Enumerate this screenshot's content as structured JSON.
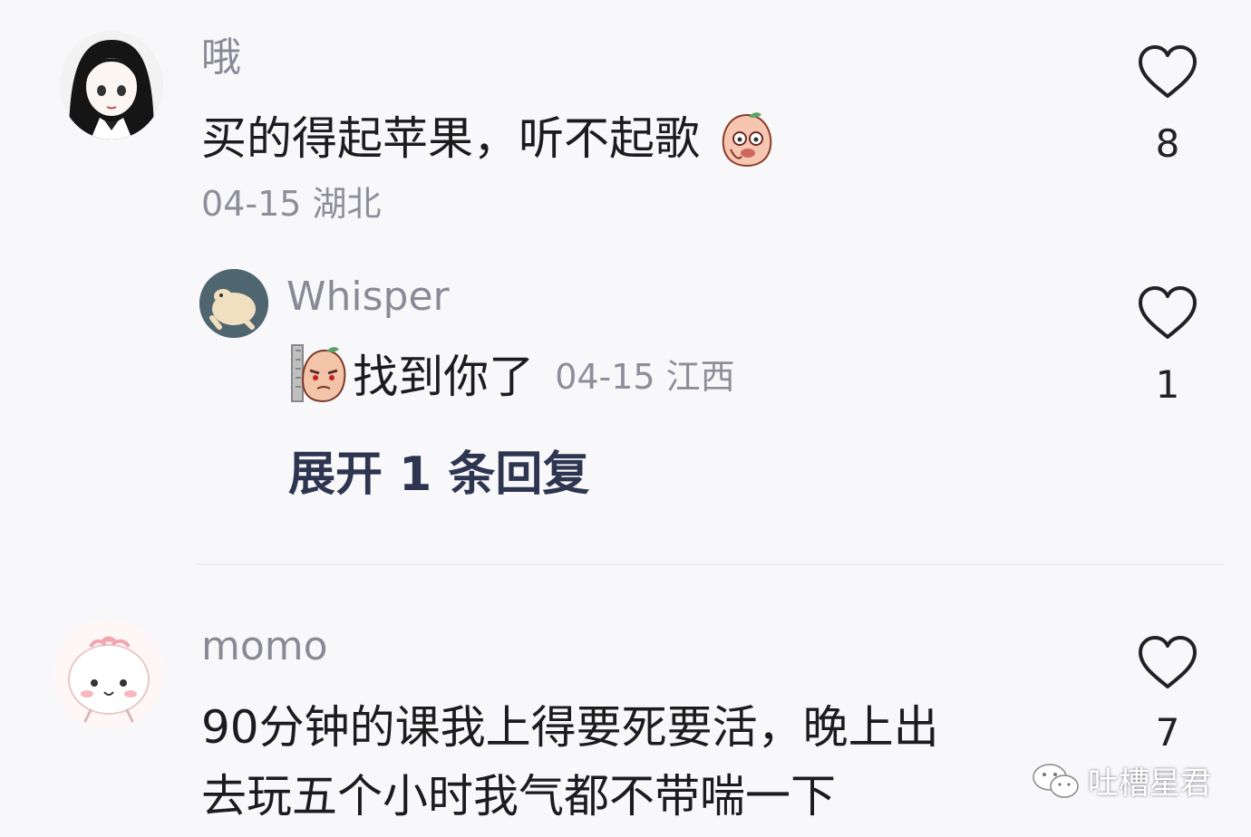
{
  "comments": [
    {
      "username": "哦",
      "text": "买的得起苹果，听不起歌",
      "meta": "04-15 湖北",
      "likes": "8"
    },
    {
      "username": "momo",
      "text_line1": "90分钟的课我上得要死要活，晚上出",
      "text_line2": "去玩五个小时我气都不带喘一下",
      "likes": "7"
    }
  ],
  "reply": {
    "username": "Whisper",
    "text": "找到你了",
    "meta": "04-15 江西",
    "likes": "1"
  },
  "expand_label": "展开 1 条回复",
  "watermark": "吐槽星君",
  "icons": {
    "like": "heart-outline-icon",
    "emoji_peach": "peach-face-emoji-icon",
    "emoji_peek": "peeking-peach-emoji-icon",
    "watermark_logo": "wechat-logo-icon"
  },
  "colors": {
    "background": "#f8f8fb",
    "username": "#8a8a96",
    "text": "#1c1c1c",
    "meta": "#8e8e9a",
    "expand": "#2e3550"
  }
}
